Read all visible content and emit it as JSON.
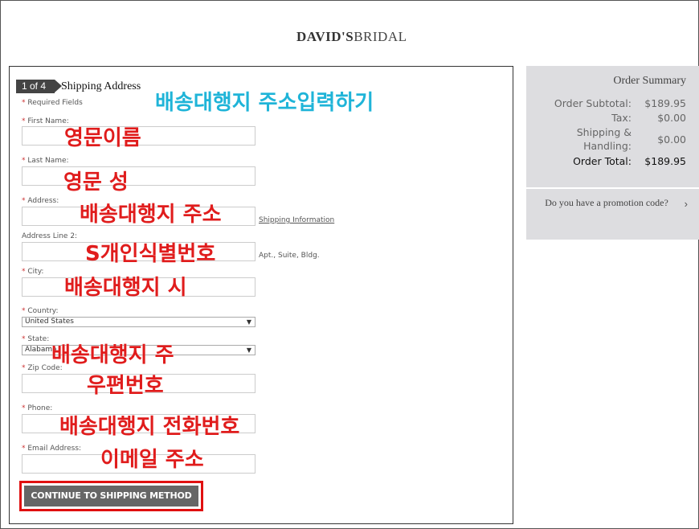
{
  "brand": {
    "logo_bold": "DAVID'S",
    "logo_light": "BRIDAL"
  },
  "checkout": {
    "step": "1 of 4",
    "step_title": "Shipping Address",
    "required_note": "Required Fields",
    "fields": {
      "first_name": "First Name:",
      "last_name": "Last Name:",
      "address": "Address:",
      "address2": "Address Line 2:",
      "city": "City:",
      "country": "Country:",
      "state": "State:",
      "zip": "Zip Code:",
      "phone": "Phone:",
      "email": "Email Address:"
    },
    "country_value": "United States",
    "state_value": "Alabama",
    "shipping_info_link": "Shipping Information",
    "address2_hint": "Apt., Suite, Bldg.",
    "required_marker": "*",
    "continue_label": "CONTINUE TO SHIPPING METHOD"
  },
  "annotations": {
    "title": "배송대행지 주소입력하기",
    "first_name": "영문이름",
    "last_name": "영문 성",
    "address": "배송대행지 주소",
    "address2": "S개인식별번호",
    "city": "배송대행지 시",
    "state": "배송대행지 주",
    "zip": "우편번호",
    "phone": "배송대행지 전화번호",
    "email": "이메일 주소"
  },
  "summary": {
    "title": "Order Summary",
    "subtotal_label": "Order Subtotal:",
    "subtotal_value": "$189.95",
    "tax_label": "Tax:",
    "tax_value": "$0.00",
    "shipping_label_1": "Shipping &",
    "shipping_label_2": "Handling:",
    "shipping_value": "$0.00",
    "total_label": "Order Total:",
    "total_value": "$189.95",
    "promo_text": "Do you have a promotion code?",
    "promo_icon": "chevron-right-icon"
  },
  "colors": {
    "annotation_red": "#e01c1c",
    "annotation_cyan": "#1fb4d8",
    "cta_bg": "#666666",
    "highlight_border": "#e01010"
  }
}
